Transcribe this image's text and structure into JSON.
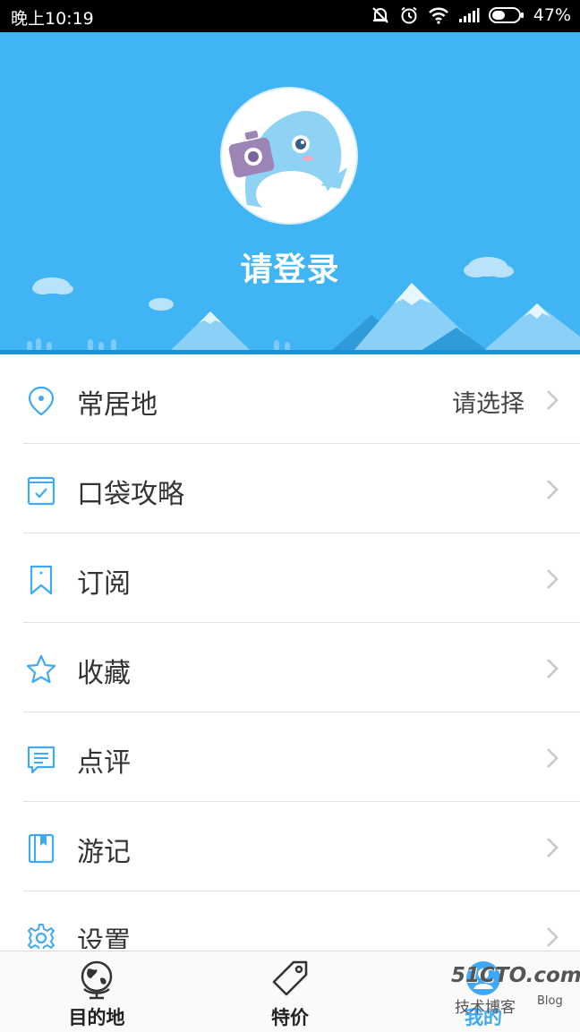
{
  "status_bar": {
    "time": "晚上10:19",
    "battery": "47%"
  },
  "profile": {
    "login_text": "请登录"
  },
  "menu": {
    "items": [
      {
        "label": "常居地",
        "value": "请选择",
        "icon": "location-pin-icon"
      },
      {
        "label": "口袋攻略",
        "icon": "checked-book-icon"
      },
      {
        "label": "订阅",
        "icon": "bookmark-icon"
      },
      {
        "label": "收藏",
        "icon": "star-icon"
      },
      {
        "label": "点评",
        "icon": "comment-icon"
      },
      {
        "label": "游记",
        "icon": "notebook-icon"
      },
      {
        "label": "设置",
        "icon": "gear-icon"
      }
    ]
  },
  "tabbar": {
    "tabs": [
      {
        "label": "目的地",
        "icon": "globe-icon"
      },
      {
        "label": "特价",
        "icon": "price-tag-icon"
      },
      {
        "label": "我的",
        "icon": "profile-icon",
        "active": true
      }
    ]
  },
  "watermark": {
    "brand": "51CTO.com",
    "sub": "技术博客",
    "blog": "Blog"
  },
  "colors": {
    "header_bg": "#41b5f4",
    "accent": "#3fa9f5",
    "icon_blue": "#3fa9f5"
  }
}
